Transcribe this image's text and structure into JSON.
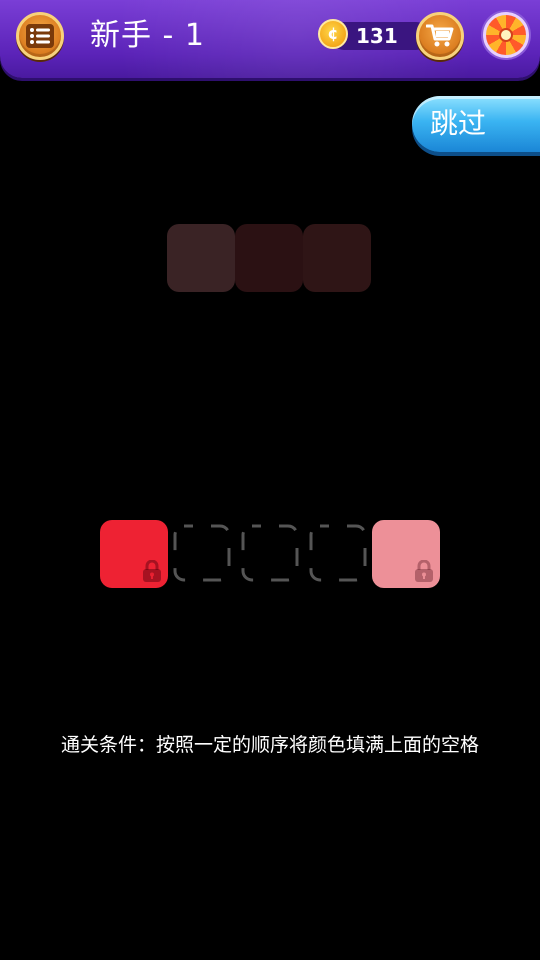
{
  "header": {
    "level_title": "新手 - 1",
    "coins": "131",
    "coin_symbol": "¢",
    "icons": {
      "menu": "list-menu-icon",
      "cart": "shopping-cart-icon",
      "wheel": "lucky-wheel-icon"
    }
  },
  "skip_label": "跳过",
  "target_colors": [
    "#3a2325",
    "#2b1113",
    "#2f1516"
  ],
  "play_row": {
    "left_tile_color": "#ee2233",
    "right_tile_color": "#ed9098",
    "empty_slots": 3
  },
  "condition_text": "通关条件：按照一定的顺序将颜色填满上面的空格"
}
